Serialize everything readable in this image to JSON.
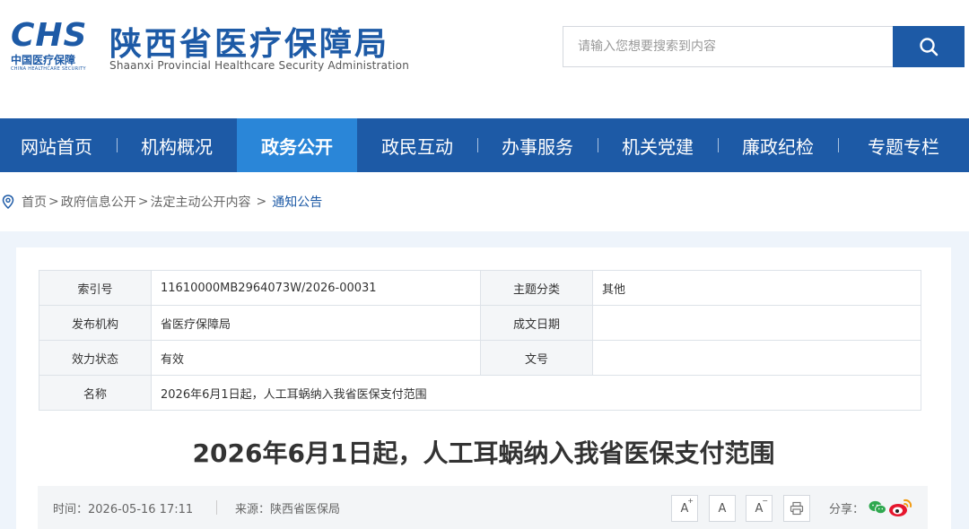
{
  "header": {
    "logo_mark": "CHS",
    "logo_cn": "中国医疗保障",
    "logo_en": "CHINA HEALTHCARE SECURITY",
    "site_title": "陕西省医疗保障局",
    "site_subtitle": "Shaanxi Provincial Healthcare Security Administration",
    "search_placeholder": "请输入您想要搜索到内容"
  },
  "nav": {
    "items": [
      {
        "label": "网站首页"
      },
      {
        "label": "机构概况"
      },
      {
        "label": "政务公开",
        "active": true
      },
      {
        "label": "政民互动"
      },
      {
        "label": "办事服务"
      },
      {
        "label": "机关党建"
      },
      {
        "label": "廉政纪检"
      },
      {
        "label": "专题专栏"
      }
    ]
  },
  "breadcrumb": {
    "items": [
      "首页",
      "政府信息公开",
      "法定主动公开内容"
    ],
    "current": "通知公告"
  },
  "meta_table": {
    "index_label": "索引号",
    "index_value": "11610000MB2964073W/2026-00031",
    "topic_label": "主题分类",
    "topic_value": "其他",
    "issuer_label": "发布机构",
    "issuer_value": "省医疗保障局",
    "date_label": "成文日期",
    "date_value": "",
    "status_label": "效力状态",
    "status_value": "有效",
    "docno_label": "文号",
    "docno_value": "",
    "name_label": "名称",
    "name_value": "2026年6月1日起，人工耳蜗纳入我省医保支付范围"
  },
  "article": {
    "title": "2026年6月1日起，人工耳蜗纳入我省医保支付范围",
    "time": "时间：2026-05-16 17:11",
    "source": "来源：陕西省医保局",
    "font_larger": "A",
    "font_normal": "A",
    "font_smaller": "A",
    "share_label": "分享："
  },
  "colors": {
    "brand": "#1d5aa6",
    "nav_active": "#2a86d8",
    "wechat": "#2fa84f",
    "weibo": "#e6162d"
  }
}
